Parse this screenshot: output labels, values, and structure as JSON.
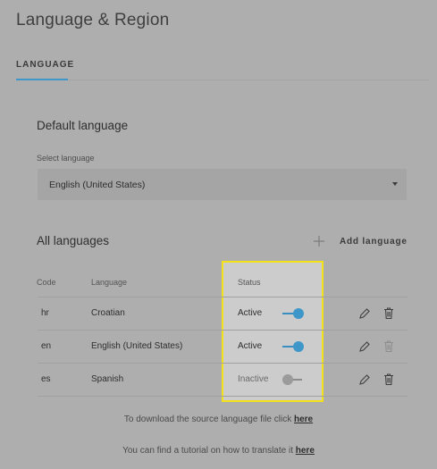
{
  "header": {
    "title": "Language & Region"
  },
  "tabs": [
    {
      "label": "LANGUAGE"
    }
  ],
  "default_language": {
    "title": "Default language",
    "field_label": "Select language",
    "selected_value": "English (United States)"
  },
  "all_languages": {
    "title": "All languages",
    "add_button_label": "Add language",
    "columns": {
      "code": "Code",
      "language": "Language",
      "status": "Status"
    },
    "rows": [
      {
        "code": "hr",
        "language": "Croatian",
        "status": "Active",
        "enabled": true
      },
      {
        "code": "en",
        "language": "English (United States)",
        "status": "Active",
        "enabled": true
      },
      {
        "code": "es",
        "language": "Spanish",
        "status": "Inactive",
        "enabled": false
      }
    ]
  },
  "footer": {
    "download_text": "To download the source language file click ",
    "download_link": "here",
    "tutorial_text": "You can find a tutorial on how to translate it ",
    "tutorial_link": "here"
  },
  "colors": {
    "accent": "#3f97c9",
    "highlight": "#f3e21a",
    "background": "#aeaeae"
  }
}
